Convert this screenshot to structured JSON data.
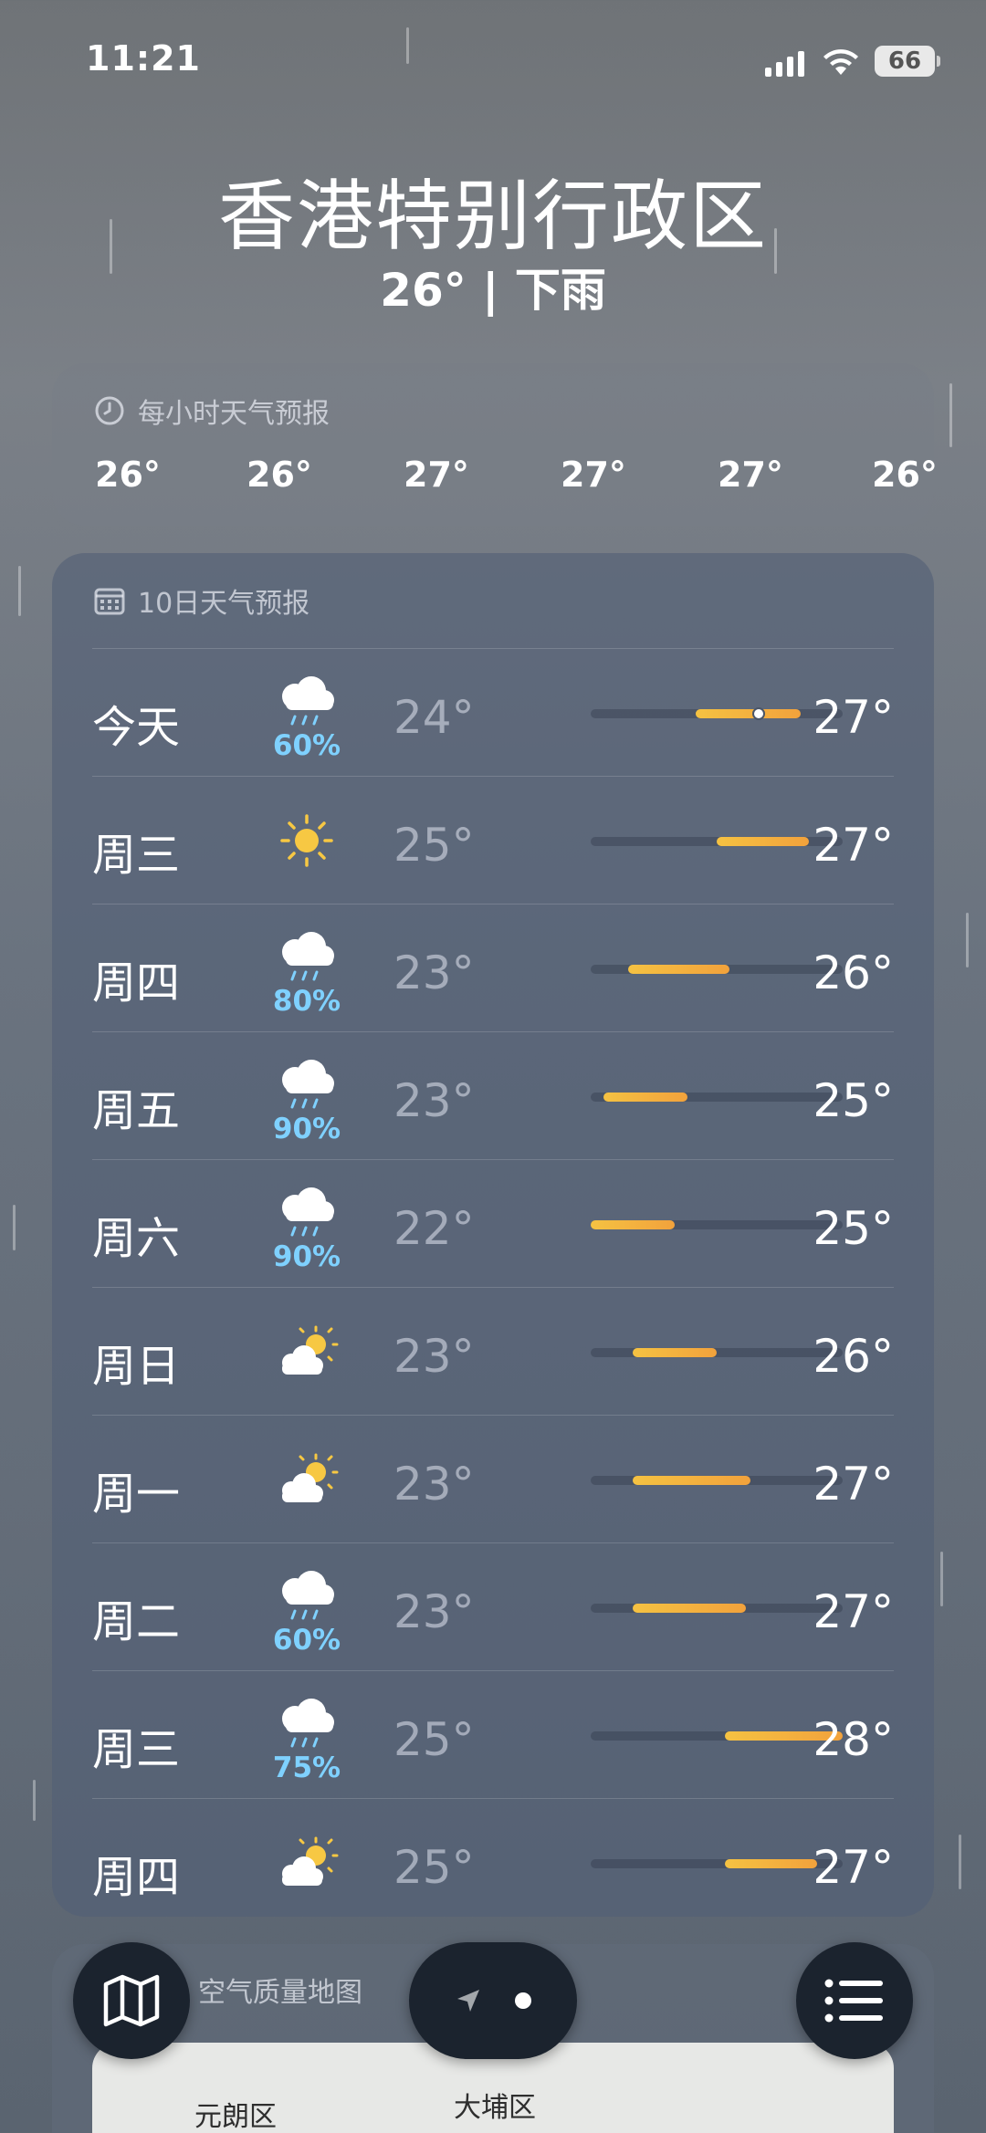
{
  "status_bar": {
    "time": "11:21",
    "battery": "66"
  },
  "location": {
    "name": "香港特别行政区",
    "summary": "26° | 下雨"
  },
  "hourly": {
    "title": "每小时天气预报",
    "icon": "clock-icon",
    "temps": [
      "26°",
      "26°",
      "27°",
      "27°",
      "27°",
      "26°"
    ]
  },
  "daily": {
    "title": "10日天气预报",
    "icon": "calendar-icon",
    "scale": {
      "min": 22,
      "max": 28
    },
    "days": [
      {
        "day": "今天",
        "icon": "rain-cloud-icon",
        "precip": "60%",
        "low": "24°",
        "high": "27°",
        "low_value": 24.5,
        "high_value": 27,
        "current": 26
      },
      {
        "day": "周三",
        "icon": "sun-icon",
        "precip": "",
        "low": "25°",
        "high": "27°",
        "low_value": 25,
        "high_value": 27.2
      },
      {
        "day": "周四",
        "icon": "rain-cloud-icon",
        "precip": "80%",
        "low": "23°",
        "high": "26°",
        "low_value": 22.9,
        "high_value": 25.3
      },
      {
        "day": "周五",
        "icon": "rain-cloud-icon",
        "precip": "90%",
        "low": "23°",
        "high": "25°",
        "low_value": 22.3,
        "high_value": 24.3
      },
      {
        "day": "周六",
        "icon": "rain-cloud-icon",
        "precip": "90%",
        "low": "22°",
        "high": "25°",
        "low_value": 22,
        "high_value": 24
      },
      {
        "day": "周日",
        "icon": "partly-sunny-icon",
        "precip": "",
        "low": "23°",
        "high": "26°",
        "low_value": 23,
        "high_value": 25
      },
      {
        "day": "周一",
        "icon": "partly-sunny-icon",
        "precip": "",
        "low": "23°",
        "high": "27°",
        "low_value": 23,
        "high_value": 25.8
      },
      {
        "day": "周二",
        "icon": "rain-cloud-icon",
        "precip": "60%",
        "low": "23°",
        "high": "27°",
        "low_value": 23,
        "high_value": 25.7
      },
      {
        "day": "周三",
        "icon": "rain-cloud-icon",
        "precip": "75%",
        "low": "25°",
        "high": "28°",
        "low_value": 25.2,
        "high_value": 28
      },
      {
        "day": "周四",
        "icon": "partly-sunny-icon",
        "precip": "",
        "low": "25°",
        "high": "27°",
        "low_value": 25.2,
        "high_value": 27.4
      }
    ]
  },
  "map_card": {
    "title": "空气质量地图",
    "labels": [
      "元朗区",
      "大埔区"
    ]
  },
  "toolbar": {
    "map_icon": "map-icon",
    "location_icon": "location-arrow-icon",
    "list_icon": "list-icon"
  },
  "colors": {
    "bar_orange": "#f2a23c",
    "bar_yellow": "#f5c242",
    "precip_blue": "#7fd1ff"
  }
}
